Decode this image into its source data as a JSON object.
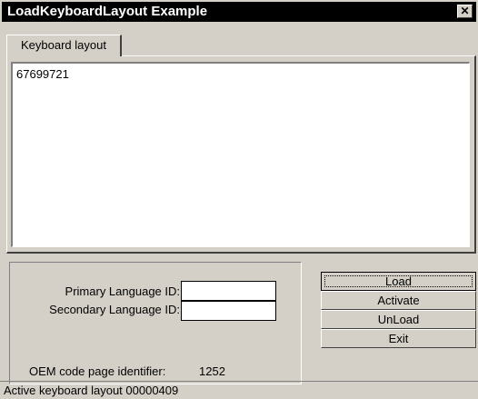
{
  "window": {
    "title": "LoadKeyboardLayout Example",
    "close_glyph": "✕"
  },
  "tabs": [
    {
      "label": "Keyboard layout"
    }
  ],
  "output": {
    "text": "67699721"
  },
  "fields": {
    "primary_language_label": "Primary Language ID:",
    "primary_language_value": "",
    "secondary_language_label": "Secondary Language ID:",
    "secondary_language_value": ""
  },
  "oem": {
    "label": "OEM code page identifier:",
    "value": "1252"
  },
  "buttons": {
    "load": "Load",
    "activate": "Activate",
    "unload": "UnLoad",
    "exit": "Exit"
  },
  "status": {
    "text": "Active keyboard layout 00000409"
  }
}
